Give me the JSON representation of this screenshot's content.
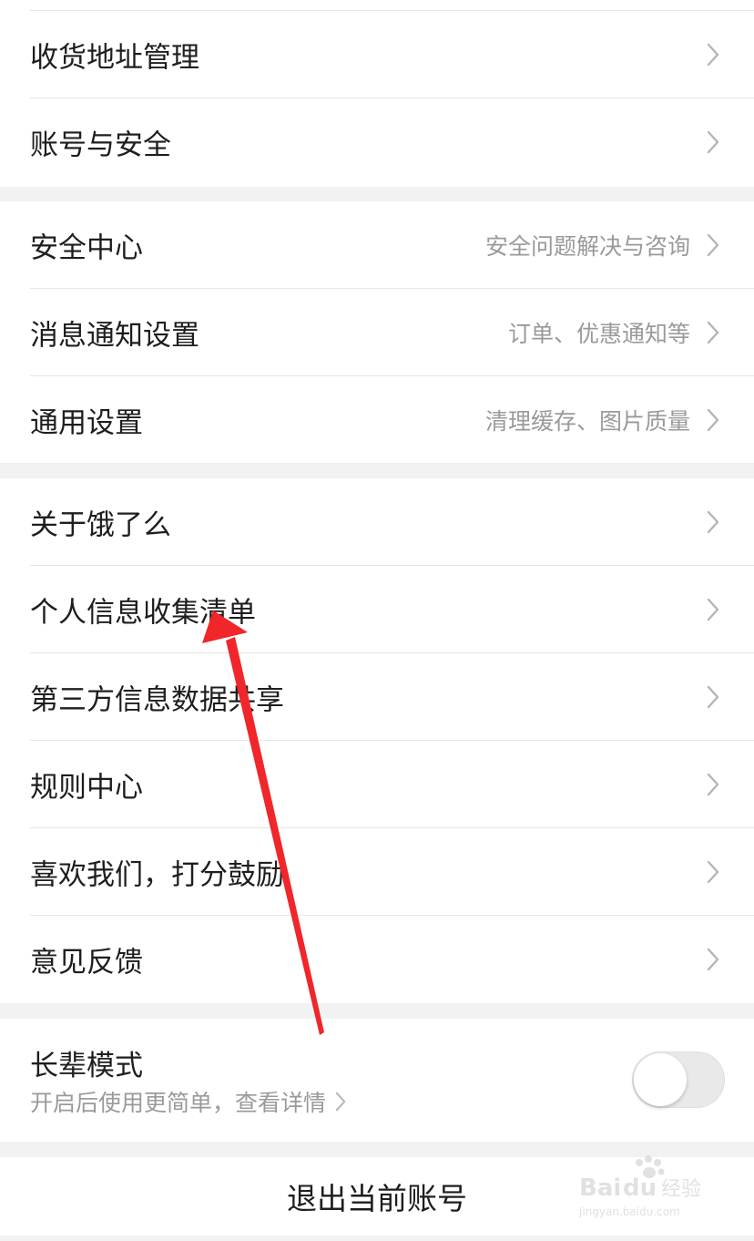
{
  "settings": {
    "group1": [
      {
        "label": "收货地址管理",
        "hint": ""
      },
      {
        "label": "账号与安全",
        "hint": ""
      }
    ],
    "group2": [
      {
        "label": "安全中心",
        "hint": "安全问题解决与咨询"
      },
      {
        "label": "消息通知设置",
        "hint": "订单、优惠通知等"
      },
      {
        "label": "通用设置",
        "hint": "清理缓存、图片质量"
      }
    ],
    "group3": [
      {
        "label": "关于饿了么",
        "hint": ""
      },
      {
        "label": "个人信息收集清单",
        "hint": ""
      },
      {
        "label": "第三方信息数据共享",
        "hint": ""
      },
      {
        "label": "规则中心",
        "hint": ""
      },
      {
        "label": "喜欢我们，打分鼓励",
        "hint": ""
      },
      {
        "label": "意见反馈",
        "hint": ""
      }
    ]
  },
  "elder_mode": {
    "title": "长辈模式",
    "description": "开启后使用更简单，查看详情",
    "enabled": false
  },
  "logout_label": "退出当前账号",
  "watermark": {
    "brand": "Baidu经验",
    "url": "jingyan.baidu.com"
  },
  "colors": {
    "annotation_arrow": "#f0262a",
    "background": "#f2f2f2",
    "secondary_text": "#9a9a9a"
  },
  "icons": {
    "row_chevron": "chevron-right-icon",
    "annotation": "red-arrow-annotation"
  }
}
